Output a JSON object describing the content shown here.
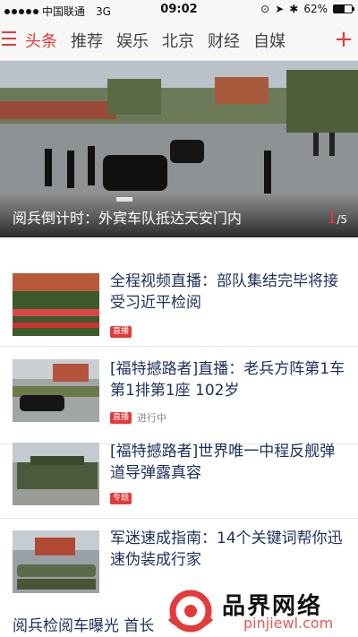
{
  "status_bar": {
    "carrier": "中国联通",
    "network": "3G",
    "time": "09:02",
    "battery": "62%",
    "battery_level": 0.62
  },
  "channels": {
    "tabs": [
      "头条",
      "推荐",
      "娱乐",
      "北京",
      "财经",
      "自媒"
    ],
    "active_index": 0,
    "add_label": "+"
  },
  "hero": {
    "caption": "阅兵倒计时：外宾车队抵达天安门内",
    "page_current": "1",
    "page_total": "/5"
  },
  "news": [
    {
      "title": "全程视频直播：部队集结完毕将接受习近平检阅",
      "tag": "直播",
      "state": ""
    },
    {
      "title": "[福特撼路者]直播：老兵方阵第1车第1排第1座 102岁",
      "tag": "直播",
      "state": "进行中"
    },
    {
      "title": "[福特撼路者]世界唯一中程反舰弹道导弹露真容",
      "tag": "专题",
      "state": ""
    },
    {
      "title": "军迷速成指南：14个关键词帮你迅速伪装成行家",
      "tag": "",
      "state": ""
    }
  ],
  "bottom_title": "阅兵检阅车曝光 首长",
  "watermark": {
    "brand": "品界网络",
    "url": "pinjiewl.com"
  },
  "colors": {
    "accent": "#e43a3a",
    "title": "#1d2f5c"
  }
}
